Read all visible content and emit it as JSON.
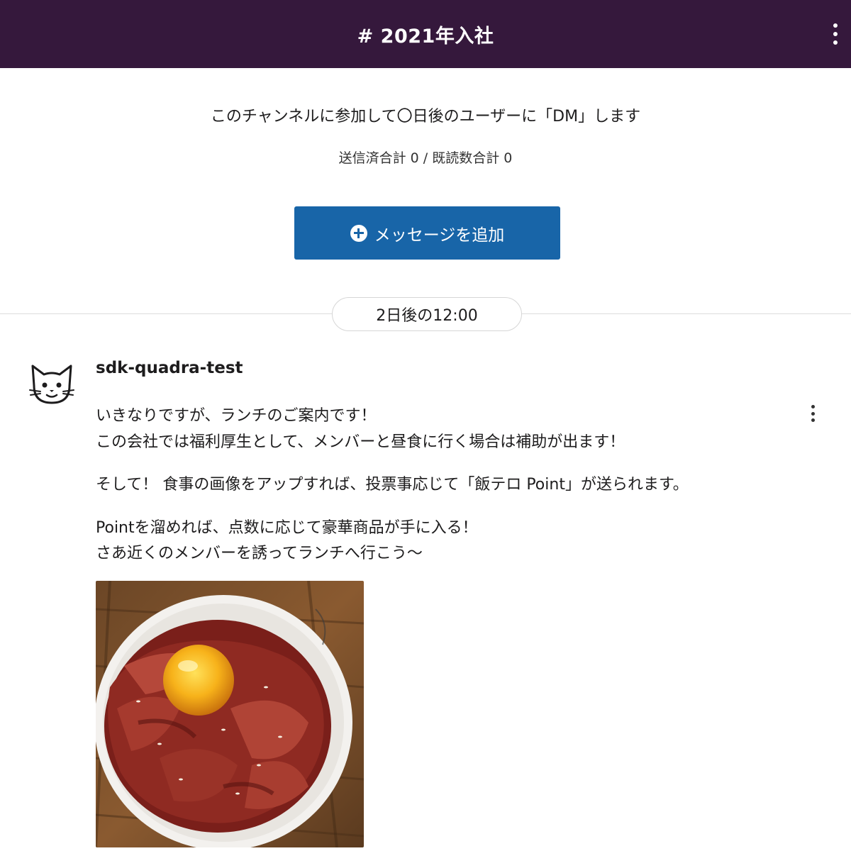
{
  "header": {
    "title": "# 2021年入社",
    "menu_icon": "more-vertical-icon",
    "background": "#35183c"
  },
  "subtitle": "このチャンネルに参加して〇日後のユーザーに「DM」します",
  "stats": "送信済合計 0 / 既読数合計 0",
  "add_button": {
    "label": "メッセージを追加",
    "icon": "plus-circle-icon",
    "color": "#1865a8"
  },
  "schedule": {
    "label": "2日後の12:00"
  },
  "message": {
    "avatar_icon": "cat-avatar-icon",
    "username": "sdk-quadra-test",
    "menu_icon": "more-vertical-icon",
    "lines": [
      "いきなりですが、ランチのご案内です！",
      "この会社では福利厚生として、メンバーと昼食に行く場合は補助が出ます！",
      "そして！ 食事の画像をアップすれば、投票事応じて「飯テロ Point」が送られます。",
      "Pointを溜めれば、点数に応じて豪華商品が手に入る！",
      "さあ近くのメンバーを誘ってランチへ行こう〜"
    ],
    "image_subject": "roast-beef-bowl-image"
  }
}
